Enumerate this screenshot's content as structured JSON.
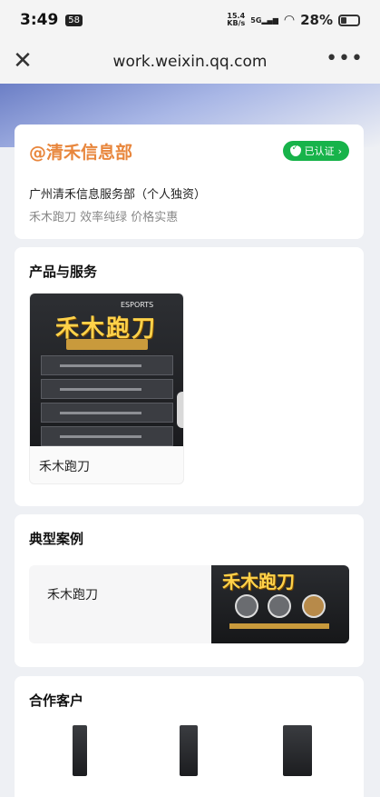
{
  "status_bar": {
    "time": "3:49",
    "notification_badge": "58",
    "net_speed_value": "15.4",
    "net_speed_unit": "KB/s",
    "signal_label": "5G",
    "battery": "28%"
  },
  "nav": {
    "close_icon": "close-icon",
    "url": "work.weixin.qq.com",
    "more_icon": "more-icon"
  },
  "company": {
    "name": "@清禾信息部",
    "verified_label": "已认证",
    "full_name": "广州清禾信息服务部（个人独资）",
    "tags": "禾木跑刀 效率纯绿 价格实惠"
  },
  "products": {
    "title": "产品与服务",
    "items": [
      {
        "label": "禾木跑刀"
      }
    ]
  },
  "cases": {
    "title": "典型案例",
    "items": [
      {
        "label": "禾木跑刀"
      }
    ]
  },
  "clients": {
    "title": "合作客户"
  },
  "colors": {
    "accent": "#e8863c",
    "verified": "#17b34a"
  }
}
